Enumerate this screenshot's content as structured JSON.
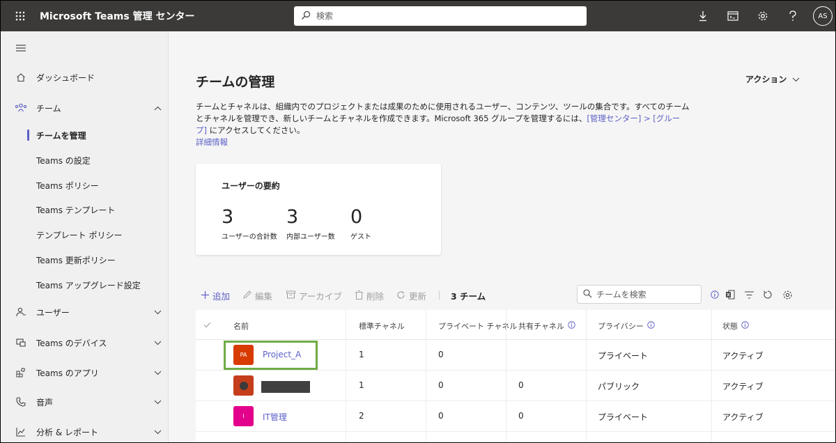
{
  "app": {
    "title": "Microsoft Teams 管理 センター",
    "search_placeholder": "検索",
    "user_initials": "AS"
  },
  "sidebar": {
    "items": [
      {
        "label": "ダッシュボード",
        "icon": "home-icon"
      },
      {
        "label": "チーム",
        "icon": "teams-icon",
        "expanded": true
      },
      {
        "label": "チームを管理",
        "active": true
      },
      {
        "label": "Teams の設定"
      },
      {
        "label": "Teams ポリシー"
      },
      {
        "label": "Teams テンプレート"
      },
      {
        "label": "テンプレート ポリシー"
      },
      {
        "label": "Teams 更新ポリシー"
      },
      {
        "label": "Teams アップグレード設定"
      },
      {
        "label": "ユーザー",
        "icon": "user-icon"
      },
      {
        "label": "Teams のデバイス",
        "icon": "device-icon"
      },
      {
        "label": "Teams のアプリ",
        "icon": "apps-icon"
      },
      {
        "label": "音声",
        "icon": "phone-icon"
      },
      {
        "label": "分析 & レポート",
        "icon": "analytics-icon"
      }
    ]
  },
  "main": {
    "title": "チームの管理",
    "actions_label": "アクション",
    "desc_text1": "チームとチャネルは、組織内でのプロジェクトまたは成果のために使用されるユーザー、コンテンツ、ツールの集合です。すべてのチームとチャネルを管理でき、新しいチームとチャネルを作成できます。Microsoft 365 グループを管理するには、",
    "desc_link": "[管理センター] > [グループ]",
    "desc_text2": " にアクセスしてください。",
    "more_info": "詳細情報"
  },
  "summary": {
    "title": "ユーザーの要約",
    "stats": [
      {
        "value": "3",
        "caption": "ユーザーの合計数"
      },
      {
        "value": "3",
        "caption": "内部ユーザー数"
      },
      {
        "value": "0",
        "caption": "ゲスト"
      }
    ]
  },
  "toolbar": {
    "add": "追加",
    "edit": "編集",
    "archive": "アーカイブ",
    "delete": "削除",
    "refresh": "更新",
    "count": "3 チーム",
    "search_placeholder": "チームを検索"
  },
  "table": {
    "columns": [
      "名前",
      "標準チャネル",
      "プライベート チャネル",
      "共有チャネル",
      "プライバシー",
      "状態"
    ],
    "rows": [
      {
        "initials": "PA",
        "name": "Project_A",
        "standard": "1",
        "private": "0",
        "shared": "",
        "privacy": "プライベート",
        "status": "アクティブ",
        "color": "#d83b01"
      },
      {
        "initials": "",
        "name": "",
        "standard": "1",
        "private": "0",
        "shared": "0",
        "privacy": "パブリック",
        "status": "アクティブ",
        "color": "#c43e1c"
      },
      {
        "initials": "I",
        "name": "IT管理",
        "standard": "2",
        "private": "0",
        "shared": "0",
        "privacy": "プライベート",
        "status": "アクティブ",
        "color": "#e3008c"
      }
    ]
  },
  "colors": {
    "accent": "#5b5fc7",
    "topbar": "#3b3a39",
    "highlight": "#6fac46"
  }
}
